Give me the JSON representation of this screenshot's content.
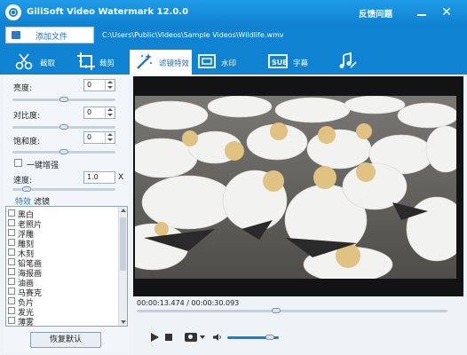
{
  "window": {
    "title": "GiliSoft Video Watermark 12.0.0",
    "feedback": "反馈问题"
  },
  "filebar": {
    "add_file": "添加文件",
    "path": "C:\\Users\\Public\\Videos\\Sample Videos\\Wildlife.wmv"
  },
  "tabs": [
    {
      "label": "截取"
    },
    {
      "label": "裁剪"
    },
    {
      "label": "滤镜特效",
      "active": true
    },
    {
      "label": "水印"
    },
    {
      "label": "字幕"
    },
    {
      "label": ""
    }
  ],
  "adjust": {
    "brightness": {
      "label": "亮度:",
      "value": "0",
      "level": 0.5
    },
    "contrast": {
      "label": "对比度:",
      "value": "0",
      "level": 0.5
    },
    "saturation": {
      "label": "饱和度:",
      "value": "0",
      "level": 0.5
    },
    "enhance": {
      "label": "一键增强",
      "checked": false
    },
    "speed": {
      "label": "速度:",
      "value": "1.0",
      "unit": "X",
      "level": 0.1
    }
  },
  "subtabs": {
    "effects": "特效",
    "filters": "滤镜"
  },
  "effects": [
    "黑白",
    "老照片",
    "浮雕",
    "雕刻",
    "木刻",
    "铅笔画",
    "海报画",
    "油画",
    "马赛克",
    "负片",
    "发光",
    "薄雾"
  ],
  "reset_label": "恢复默认",
  "player": {
    "time": "00:00:13.474 / 00:00:30.093",
    "progress": 0.448,
    "volume": 0.9
  },
  "colors": {
    "titlebar": "#0f82d2",
    "accent": "#1a7fd0",
    "active_tab_text": "#1a6bb6"
  }
}
